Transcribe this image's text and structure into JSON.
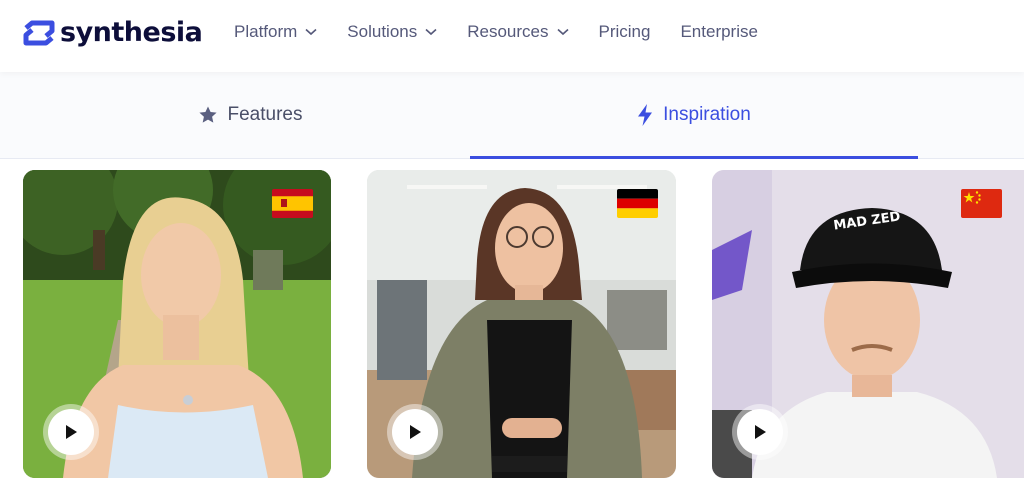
{
  "brand": {
    "name": "synthesia",
    "logo_color": "#3b4ee0"
  },
  "nav": {
    "items": [
      {
        "label": "Platform",
        "has_dropdown": true
      },
      {
        "label": "Solutions",
        "has_dropdown": true
      },
      {
        "label": "Resources",
        "has_dropdown": true
      },
      {
        "label": "Pricing",
        "has_dropdown": false
      },
      {
        "label": "Enterprise",
        "has_dropdown": false
      }
    ]
  },
  "tabs": {
    "features": {
      "label": "Features",
      "icon": "star-icon",
      "active": false
    },
    "inspiration": {
      "label": "Inspiration",
      "icon": "lightning-icon",
      "active": true
    },
    "accent_color": "#3b4ee0"
  },
  "videos": [
    {
      "flag": "spain-flag-icon",
      "language": "Spanish",
      "play_icon": "play-icon"
    },
    {
      "flag": "germany-flag-icon",
      "language": "German",
      "play_icon": "play-icon"
    },
    {
      "flag": "china-flag-icon",
      "language": "Chinese",
      "play_icon": "play-icon",
      "cap_text": "MAD ZED"
    }
  ]
}
